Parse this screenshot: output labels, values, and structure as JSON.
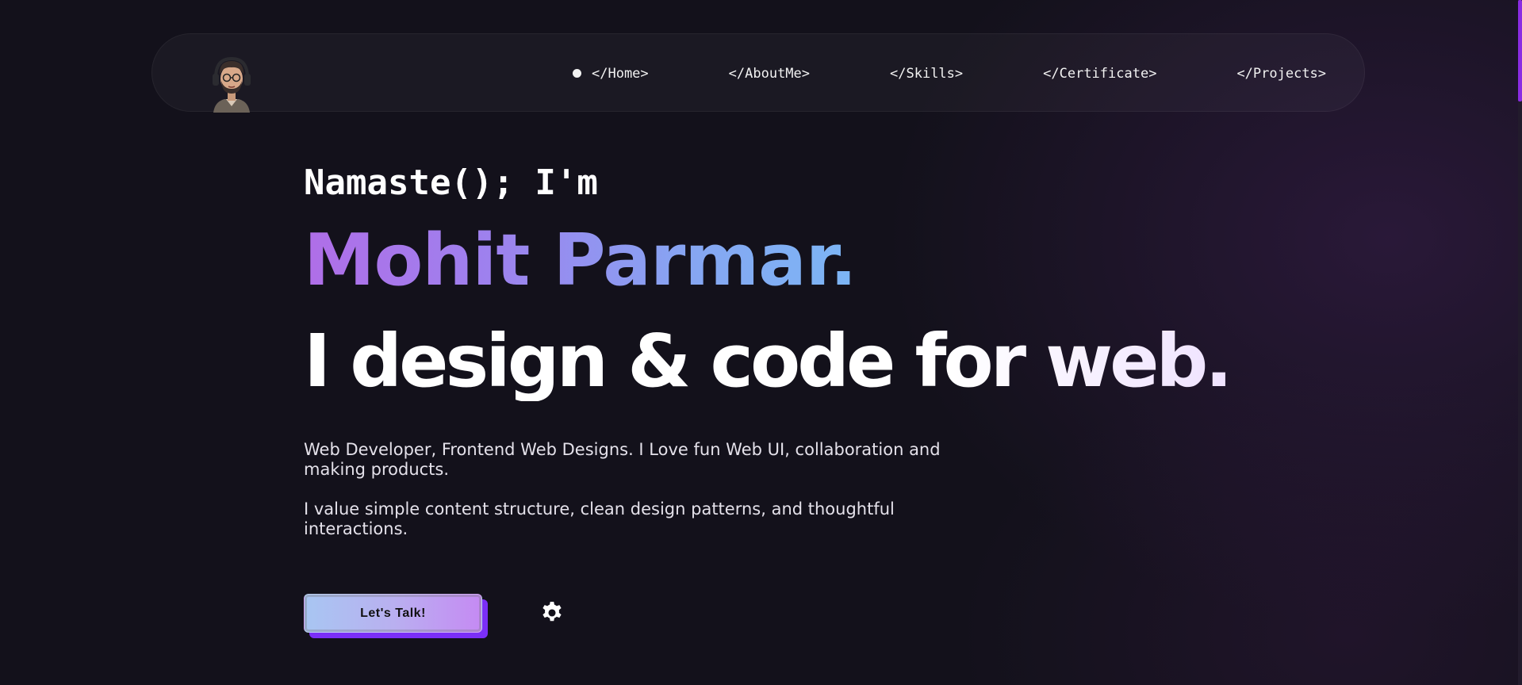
{
  "nav": {
    "items": [
      {
        "label": "</Home>",
        "active": true
      },
      {
        "label": "</AboutMe>"
      },
      {
        "label": "</Skills>"
      },
      {
        "label": "</Certificate>"
      },
      {
        "label": "</Projects>"
      }
    ]
  },
  "hero": {
    "greeting": "Namaste(); I'm",
    "name": "Mohit Parmar.",
    "tagline": "I design & code for web.",
    "paragraph_1": "Web Developer, Frontend Web Designs. I Love fun Web UI, collaboration and making products.",
    "paragraph_2": "I value simple content structure, clean design patterns, and thoughtful interactions.",
    "cta_label": "Let's Talk!"
  },
  "icons": {
    "avatar": "avatar-icon",
    "settings": "gear-icon",
    "active_nav": "dot-icon"
  },
  "colors": {
    "background": "#13111b",
    "accent": "#8a2be2",
    "name_gradient_start": "#b06ee8",
    "name_gradient_end": "#7cb6f5",
    "cta_shadow": "#7b2ff7"
  }
}
